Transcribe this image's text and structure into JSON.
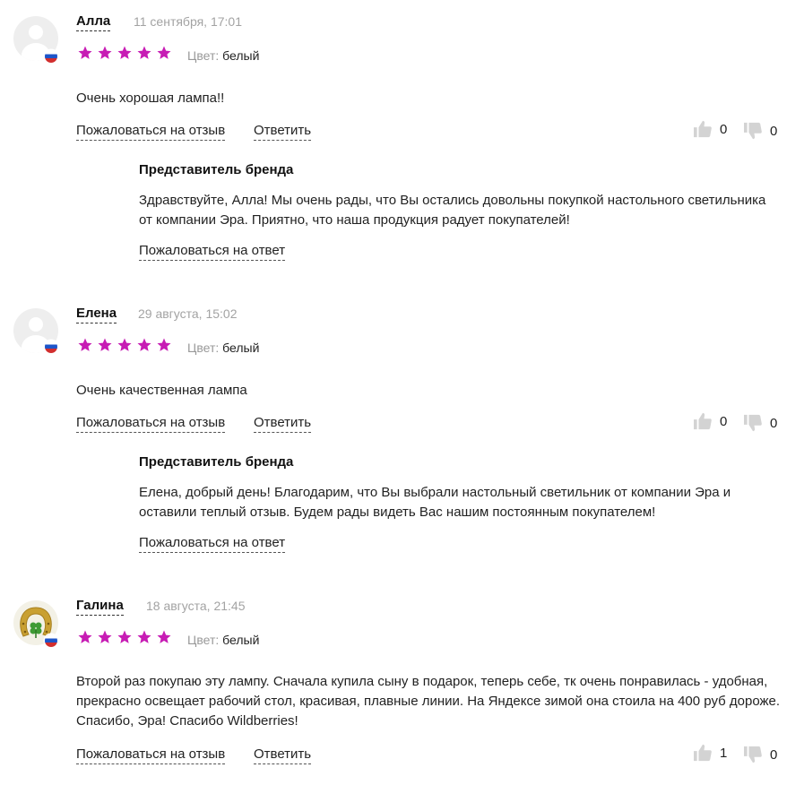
{
  "color_label": "Цвет:",
  "brand_title": "Представитель бренда",
  "complain_review_label": "Пожаловаться на отзыв",
  "reply_label": "Ответить",
  "complain_answer_label": "Пожаловаться на ответ",
  "star_color": "#c71cb4",
  "reviews": [
    {
      "name": "Алла",
      "date": "11 сентября, 17:01",
      "rating": 5,
      "color_value": "белый",
      "text": "Очень хорошая лампа!!",
      "likes": "0",
      "dislikes": "0",
      "brand_answer": "Здравствуйте, Алла! Мы очень рады, что Вы остались довольны покупкой настольного светильника от компании Эра. Приятно, что наша продукция радует покупателей!"
    },
    {
      "name": "Елена",
      "date": "29 августа, 15:02",
      "rating": 5,
      "color_value": "белый",
      "text": "Очень качественная лампа",
      "likes": "0",
      "dislikes": "0",
      "brand_answer": "Елена, добрый день! Благодарим, что Вы выбрали настольный светильник от компании Эра и оставили теплый отзыв. Будем рады видеть Вас нашим постоянным покупателем!"
    },
    {
      "name": "Галина",
      "date": "18 августа, 21:45",
      "rating": 5,
      "color_value": "белый",
      "text": "Второй раз покупаю эту лампу. Сначала купила сыну в подарок, теперь себе, тк очень понравилась - удобная, прекрасно освещает рабочий стол, красивая, плавные линии. На Яндексе зимой она стоила на 400 руб дороже. Спасибо, Эра! Спасибо Wildberries!",
      "likes": "1",
      "dislikes": "0"
    }
  ]
}
